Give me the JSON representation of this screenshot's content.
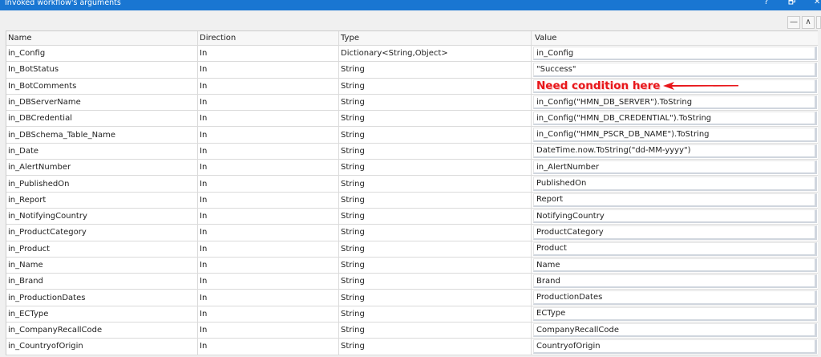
{
  "window": {
    "title": "Invoked workflow's arguments",
    "help": "?",
    "restore": "🗗",
    "close": "✕"
  },
  "toolbar": {
    "minimize": "—",
    "collapse": "∧"
  },
  "columns": [
    "Name",
    "Direction",
    "Type",
    "Value"
  ],
  "annotation": {
    "text": "Need condition here",
    "color": "#e8161a"
  },
  "rows": [
    {
      "name": "in_Config",
      "direction": "In",
      "type": "Dictionary<String,Object>",
      "value": "in_Config"
    },
    {
      "name": "In_BotStatus",
      "direction": "In",
      "type": "String",
      "value": "\"Success\""
    },
    {
      "name": "In_BotComments",
      "direction": "In",
      "type": "String",
      "value": ""
    },
    {
      "name": "in_DBServerName",
      "direction": "In",
      "type": "String",
      "value": "in_Config(\"HMN_DB_SERVER\").ToString"
    },
    {
      "name": "in_DBCredential",
      "direction": "In",
      "type": "String",
      "value": "in_Config(\"HMN_DB_CREDENTIAL\").ToString"
    },
    {
      "name": "in_DBSchema_Table_Name",
      "direction": "In",
      "type": "String",
      "value": "in_Config(\"HMN_PSCR_DB_NAME\").ToString"
    },
    {
      "name": "in_Date",
      "direction": "In",
      "type": "String",
      "value": "DateTime.now.ToString(\"dd-MM-yyyy\")"
    },
    {
      "name": "in_AlertNumber",
      "direction": "In",
      "type": "String",
      "value": "in_AlertNumber"
    },
    {
      "name": "in_PublishedOn",
      "direction": "In",
      "type": "String",
      "value": "PublishedOn"
    },
    {
      "name": "in_Report",
      "direction": "In",
      "type": "String",
      "value": "Report"
    },
    {
      "name": "in_NotifyingCountry",
      "direction": "In",
      "type": "String",
      "value": "NotifyingCountry"
    },
    {
      "name": "in_ProductCategory",
      "direction": "In",
      "type": "String",
      "value": "ProductCategory"
    },
    {
      "name": "in_Product",
      "direction": "In",
      "type": "String",
      "value": "Product"
    },
    {
      "name": "in_Name",
      "direction": "In",
      "type": "String",
      "value": "Name"
    },
    {
      "name": "in_Brand",
      "direction": "In",
      "type": "String",
      "value": "Brand"
    },
    {
      "name": "in_ProductionDates",
      "direction": "In",
      "type": "String",
      "value": "ProductionDates"
    },
    {
      "name": "in_ECType",
      "direction": "In",
      "type": "String",
      "value": "ECType"
    },
    {
      "name": "in_CompanyRecallCode",
      "direction": "In",
      "type": "String",
      "value": "CompanyRecallCode"
    },
    {
      "name": "in_CountryofOrigin",
      "direction": "In",
      "type": "String",
      "value": "CountryofOrigin"
    }
  ]
}
